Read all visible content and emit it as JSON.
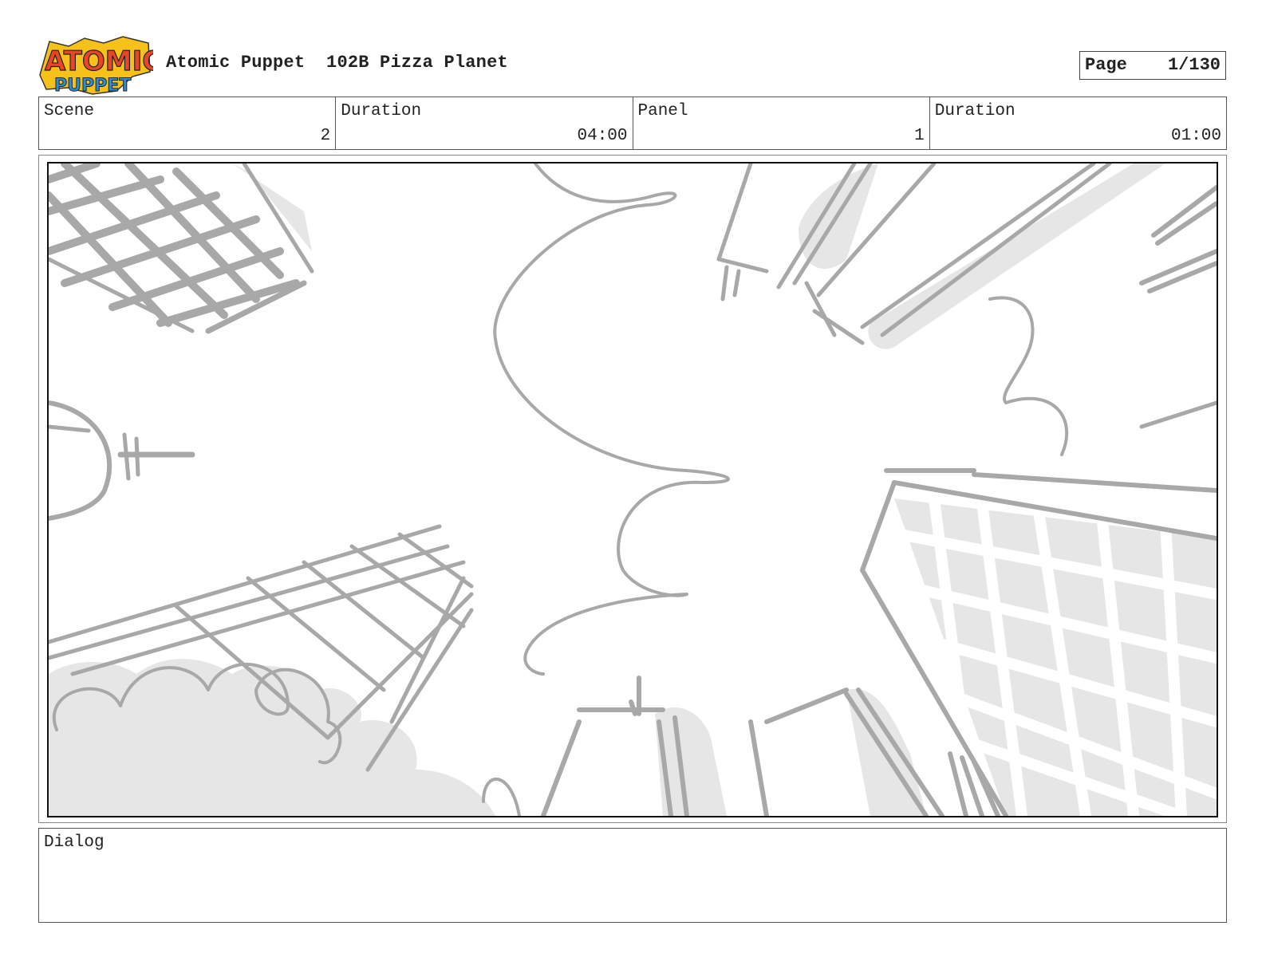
{
  "header": {
    "logo": {
      "line1": "ATOMIC",
      "line2": "PUPPET"
    },
    "show_name": "Atomic Puppet",
    "episode": "102B Pizza Planet",
    "page_label": "Page",
    "page_value": "1/130"
  },
  "info": {
    "scene_label": "Scene",
    "scene_value": "2",
    "scene_duration_label": "Duration",
    "scene_duration_value": "04:00",
    "panel_label": "Panel",
    "panel_value": "1",
    "panel_duration_label": "Duration",
    "panel_duration_value": "01:00"
  },
  "dialog": {
    "label": "Dialog",
    "text": ""
  },
  "colors": {
    "sketch_stroke": "#a8a8a8",
    "sketch_fill": "#e6e6e6",
    "logo_red": "#e8452a",
    "logo_blue": "#2a8fd8",
    "logo_yellow": "#f6c21a"
  }
}
